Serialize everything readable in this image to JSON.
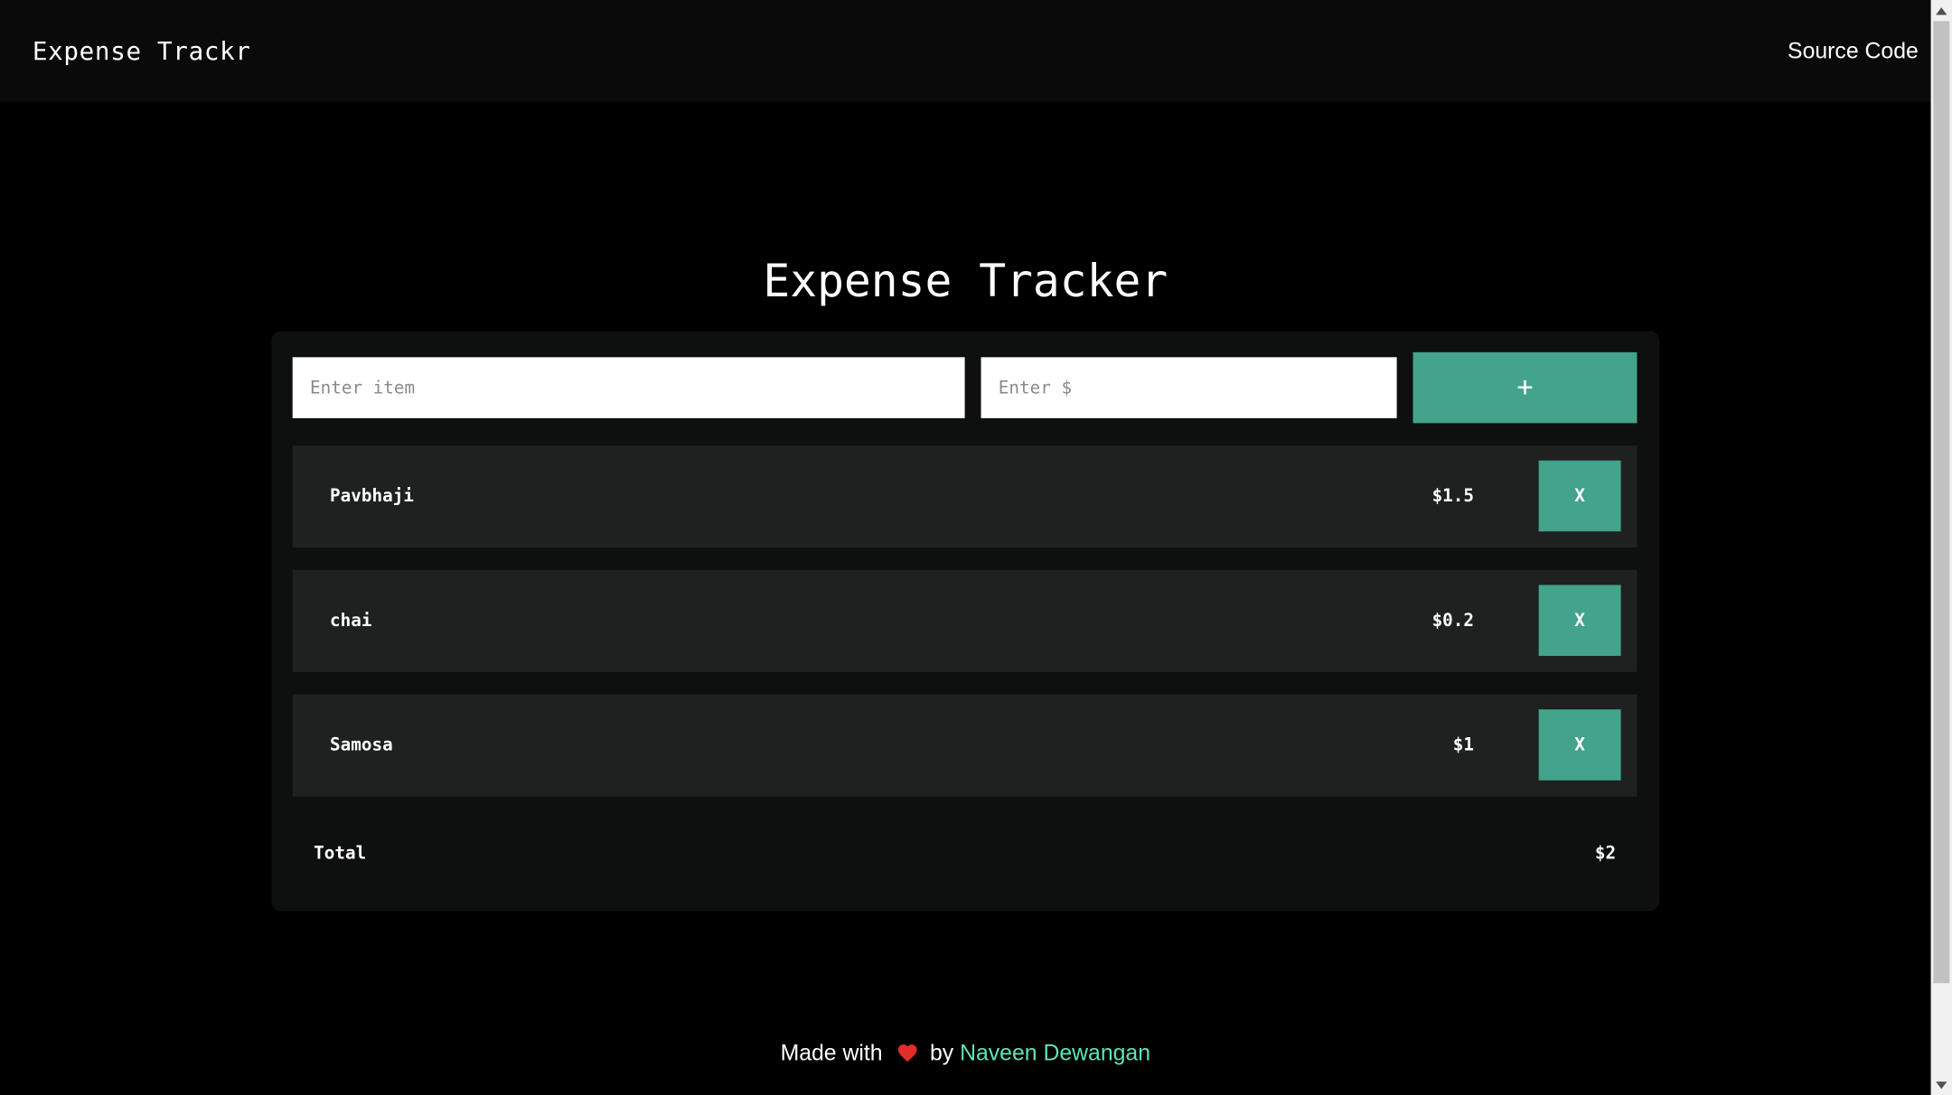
{
  "header": {
    "brand": "Expense Trackr",
    "source_link": "Source Code"
  },
  "main": {
    "title": "Expense Tracker",
    "item_input_placeholder": "Enter item",
    "amount_input_placeholder": "Enter $",
    "add_button_label": "+",
    "expenses": [
      {
        "name": "Pavbhaji",
        "amount": "$1.5",
        "delete_label": "X"
      },
      {
        "name": "chai",
        "amount": "$0.2",
        "delete_label": "X"
      },
      {
        "name": "Samosa",
        "amount": "$1",
        "delete_label": "X"
      }
    ],
    "total_label": "Total",
    "total_value": "$2"
  },
  "footer": {
    "made_with": "Made with",
    "heart_icon": "heart-icon",
    "by": "by",
    "author": "Naveen Dewangan"
  },
  "colors": {
    "accent": "#43a38b",
    "author_link": "#5ee3bd",
    "row_bg": "#1f2121",
    "card_bg": "#0e0f0f",
    "heart": "#e52d27"
  }
}
